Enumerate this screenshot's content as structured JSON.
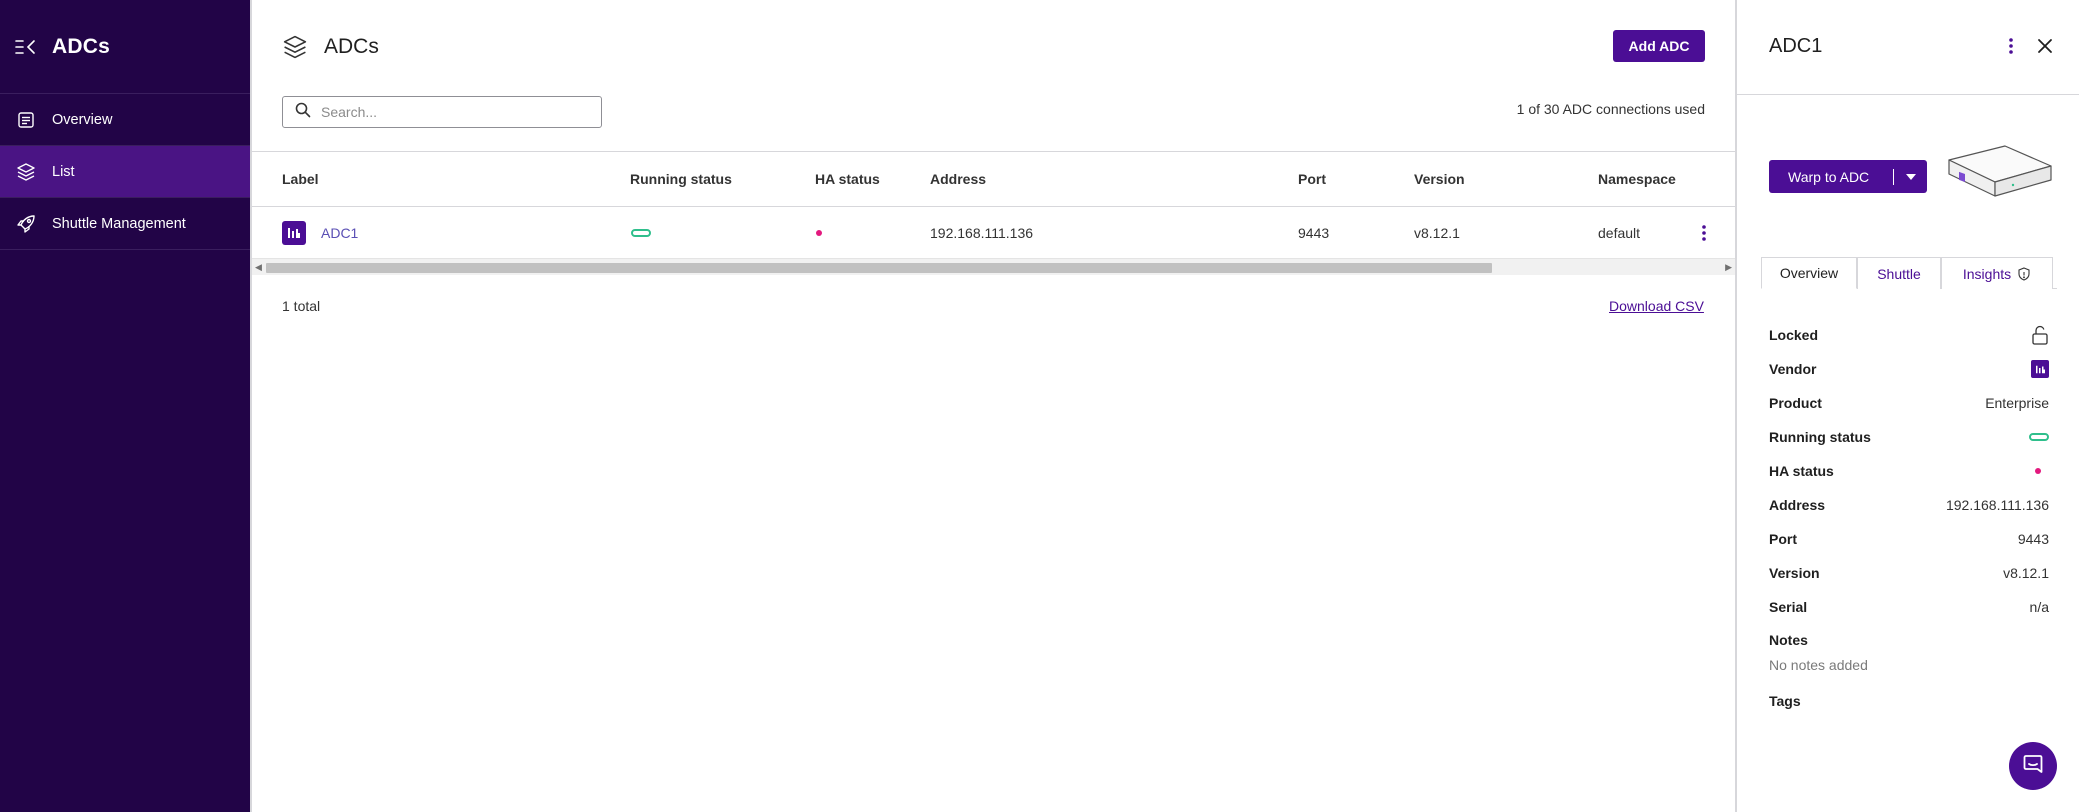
{
  "sidebar": {
    "title": "ADCs",
    "items": [
      {
        "label": "Overview",
        "icon": "overview-icon"
      },
      {
        "label": "List",
        "icon": "layers-icon"
      },
      {
        "label": "Shuttle Management",
        "icon": "rocket-icon"
      }
    ]
  },
  "main": {
    "title": "ADCs",
    "add_button": "Add ADC",
    "search": {
      "placeholder": "Search...",
      "value": ""
    },
    "connections_used": "1 of 30 ADC connections used",
    "table": {
      "columns": [
        "Label",
        "Running status",
        "HA status",
        "Address",
        "Port",
        "Version",
        "Namespace"
      ],
      "rows": [
        {
          "label": "ADC1",
          "running_status": "running",
          "ha_status": "standalone",
          "address": "192.168.111.136",
          "port": "9443",
          "version": "v8.12.1",
          "namespace": "default"
        }
      ]
    },
    "total": "1 total",
    "download_csv": "Download CSV"
  },
  "panel": {
    "title": "ADC1",
    "warp_button": "Warp to ADC",
    "tabs": [
      "Overview",
      "Shuttle",
      "Insights"
    ],
    "properties": [
      {
        "key": "Locked",
        "value": ""
      },
      {
        "key": "Vendor",
        "value": ""
      },
      {
        "key": "Product",
        "value": "Enterprise"
      },
      {
        "key": "Running status",
        "value": ""
      },
      {
        "key": "HA status",
        "value": ""
      },
      {
        "key": "Address",
        "value": "192.168.111.136"
      },
      {
        "key": "Port",
        "value": "9443"
      },
      {
        "key": "Version",
        "value": "v8.12.1"
      },
      {
        "key": "Serial",
        "value": "n/a"
      }
    ],
    "notes_label": "Notes",
    "notes_value": "No notes added",
    "tags_label": "Tags"
  },
  "colors": {
    "sidebar_bg": "#220447",
    "sidebar_active": "#4a1484",
    "accent": "#4b0e95",
    "running": "#2fbf8c",
    "ha_dot": "#e3197e"
  }
}
